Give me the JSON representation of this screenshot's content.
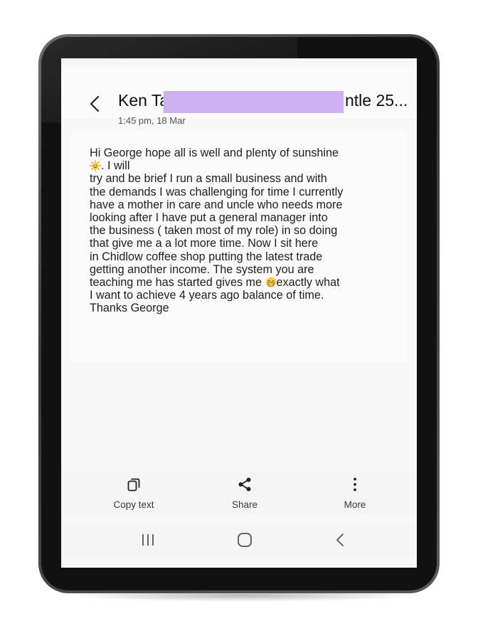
{
  "header": {
    "back_icon": "chevron-left-icon",
    "contact_name_visible": "Ken Ta",
    "contact_name_tail": "ntle 25...",
    "timestamp": "1:45 pm, 18 Mar"
  },
  "message": {
    "lines": [
      "Hi George hope all is well and  plenty of sunshine",
      ". I will",
      " try and be brief I run a small business and with",
      "the demands I was challenging for time I currently",
      "have a mother in care and uncle who needs more",
      "looking after I have put a general manager into",
      "the business ( taken most of my role) in so doing",
      "that give me a a lot more time. Now I sit here",
      "in Chidlow coffee shop putting the latest trade",
      "getting another income. The system you are",
      "teaching me has started  gives me ",
      "exactly what",
      "I want to achieve 4 years ago balance of time.",
      "Thanks George"
    ],
    "emojis": [
      "sun-emoji",
      "grinning-face-emoji"
    ]
  },
  "actions": [
    {
      "label": "Copy text",
      "icon": "copy-icon"
    },
    {
      "label": "Share",
      "icon": "share-icon"
    },
    {
      "label": "More",
      "icon": "more-vertical-icon"
    }
  ],
  "navigation": {
    "recent_icon": "recent-apps-icon",
    "home_icon": "home-icon",
    "back_icon": "back-icon"
  },
  "colors": {
    "redaction": "#cdb0ef",
    "screen_bg": "#f7f7f7",
    "text": "#1e1e1e"
  }
}
